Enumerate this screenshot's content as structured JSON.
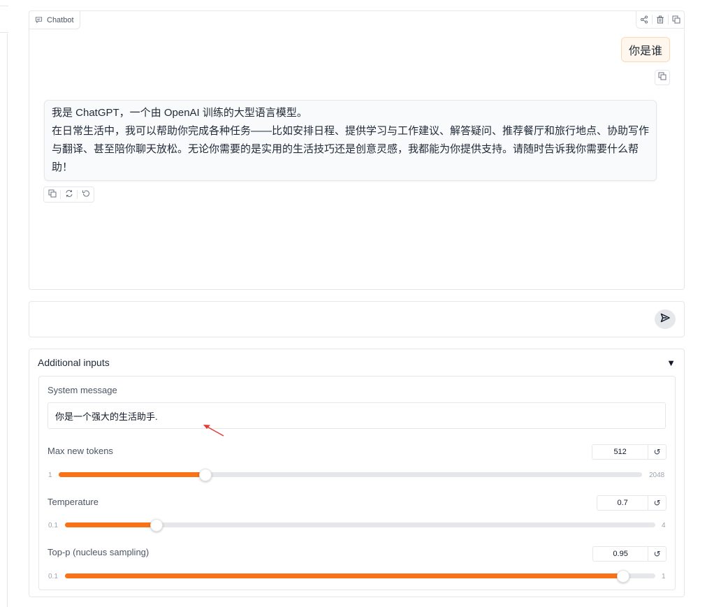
{
  "chatbot": {
    "label": "Chatbot",
    "user_message": "你是谁",
    "bot_message_lines": [
      "我是 ChatGPT，一个由 OpenAI 训练的大型语言模型。",
      "在日常生活中，我可以帮助你完成各种任务——比如安排日程、提供学习与工作建议、解答疑问、推荐餐厅和旅行地点、协助写作与翻译、甚至陪你聊天放松。无论你需要的是实用的生活技巧还是创意灵感，我都能为你提供支持。请随时告诉我你需要什么帮助！"
    ],
    "header_actions": [
      "share-icon",
      "trash-icon",
      "copy-icon"
    ],
    "message_actions": [
      "copy-icon",
      "retry-icon",
      "undo-icon"
    ]
  },
  "input": {
    "value": "",
    "send_icon": "send-icon"
  },
  "additional_inputs": {
    "title": "Additional inputs",
    "toggle": "▼",
    "system_message": {
      "label": "System message",
      "value": "你是一个强大的生活助手."
    },
    "sliders": [
      {
        "label": "Max new tokens",
        "value": "512",
        "min": "1",
        "max": "2048",
        "fraction": 0.25
      },
      {
        "label": "Temperature",
        "value": "0.7",
        "min": "0.1",
        "max": "4",
        "fraction": 0.154
      },
      {
        "label": "Top-p (nucleus sampling)",
        "value": "0.95",
        "min": "0.1",
        "max": "1",
        "fraction": 0.944
      }
    ],
    "reset_symbol": "↺"
  },
  "colors": {
    "accent": "#f97316",
    "user_bubble": "#fff7ed",
    "annotation_arrow": "#e53935"
  }
}
